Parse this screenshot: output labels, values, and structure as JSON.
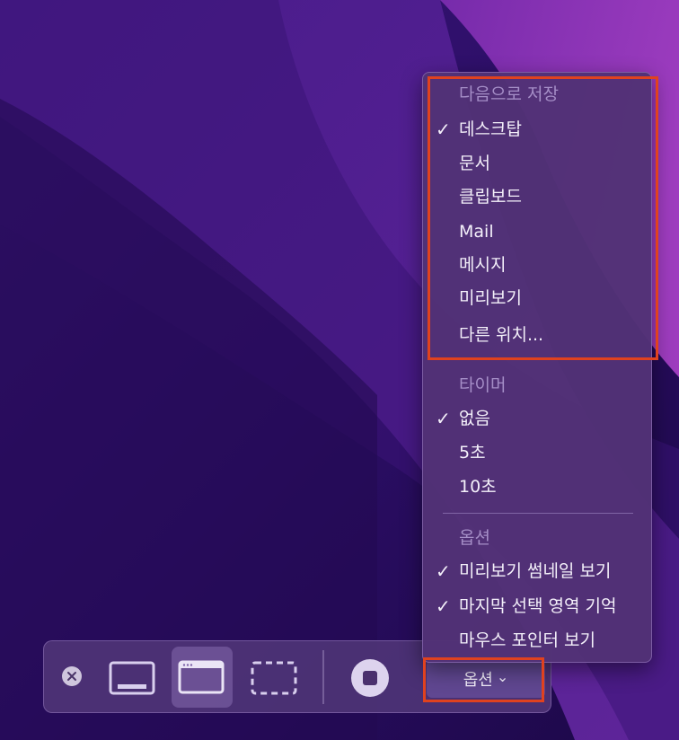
{
  "menu": {
    "save_to": {
      "header": "다음으로 저장",
      "items": [
        {
          "label": "데스크탑",
          "checked": true
        },
        {
          "label": "문서",
          "checked": false
        },
        {
          "label": "클립보드",
          "checked": false
        },
        {
          "label": "Mail",
          "checked": false
        },
        {
          "label": "메시지",
          "checked": false
        },
        {
          "label": "미리보기",
          "checked": false
        },
        {
          "label": "다른 위치...",
          "checked": false
        }
      ]
    },
    "timer": {
      "header": "타이머",
      "items": [
        {
          "label": "없음",
          "checked": true
        },
        {
          "label": "5초",
          "checked": false
        },
        {
          "label": "10초",
          "checked": false
        }
      ]
    },
    "options": {
      "header": "옵션",
      "items": [
        {
          "label": "미리보기 썸네일 보기",
          "checked": true
        },
        {
          "label": "마지막 선택 영역 기억",
          "checked": true
        },
        {
          "label": "마우스 포인터 보기",
          "checked": false
        }
      ]
    },
    "check_glyph": "✓"
  },
  "toolbar": {
    "options_label": "옵션",
    "options_chevron": "⌄",
    "icons": [
      "close-icon",
      "capture-entire-screen-icon",
      "capture-window-icon",
      "capture-selection-icon",
      "record-stop-icon"
    ]
  },
  "colors": {
    "highlight": "#e0421f",
    "menu_bg": "#523276",
    "header_text": "#a58ec7"
  }
}
